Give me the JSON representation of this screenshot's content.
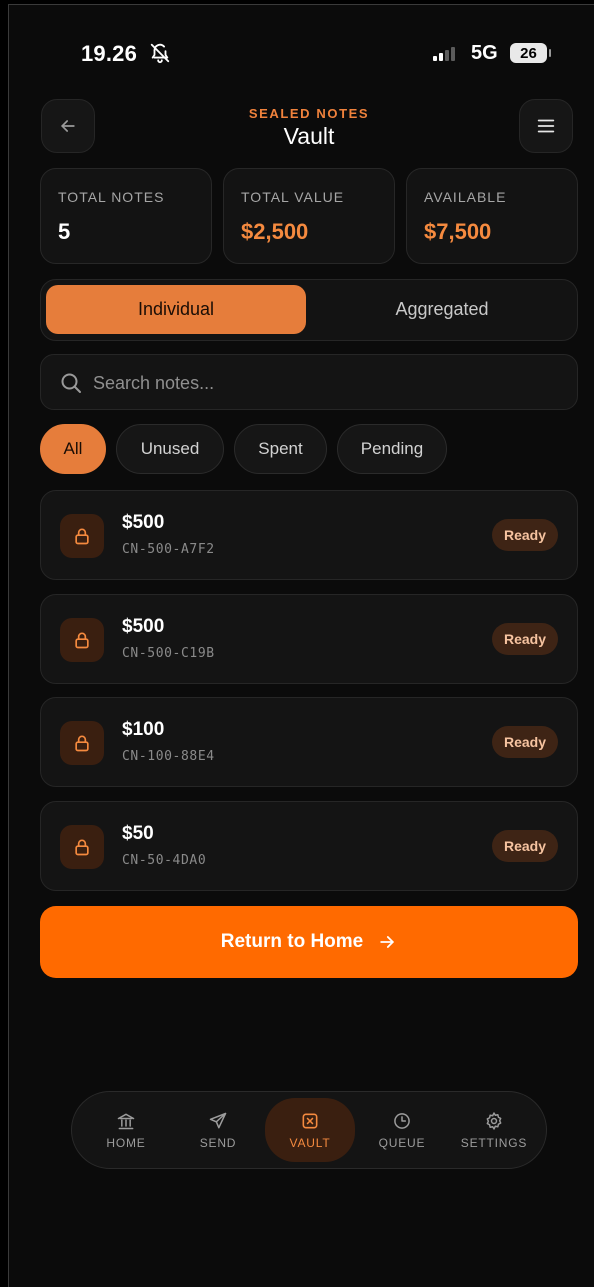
{
  "status_bar": {
    "time": "19.26",
    "network": "5G",
    "battery": "26"
  },
  "header": {
    "eyebrow": "SEALED NOTES",
    "title": "Vault"
  },
  "stats": [
    {
      "label": "TOTAL NOTES",
      "value": "5"
    },
    {
      "label": "TOTAL VALUE",
      "value": "$2,500"
    },
    {
      "label": "AVAILABLE",
      "value": "$7,500"
    }
  ],
  "view_toggle": {
    "individual": "Individual",
    "aggregated": "Aggregated",
    "selected": "Individual"
  },
  "search": {
    "placeholder": "Search notes...",
    "value": ""
  },
  "filters": [
    "All",
    "Unused",
    "Spent",
    "Pending"
  ],
  "active_filter": "All",
  "notes": [
    {
      "amount": "$500",
      "code": "CN-500-A7F2",
      "status": "Ready"
    },
    {
      "amount": "$500",
      "code": "CN-500-C19B",
      "status": "Ready"
    },
    {
      "amount": "$100",
      "code": "CN-100-88E4",
      "status": "Ready"
    },
    {
      "amount": "$50",
      "code": "CN-50-4DA0",
      "status": "Ready"
    }
  ],
  "cta": {
    "label": "Return to Home"
  },
  "nav": [
    {
      "label": "HOME",
      "icon": "bank-icon"
    },
    {
      "label": "SEND",
      "icon": "send-icon"
    },
    {
      "label": "VAULT",
      "icon": "vault-icon"
    },
    {
      "label": "QUEUE",
      "icon": "clock-icon"
    },
    {
      "label": "SETTINGS",
      "icon": "gear-icon"
    }
  ],
  "active_nav": "VAULT",
  "colors": {
    "accent": "#f58a3f",
    "cta": "#ff6a00",
    "background": "#0b0b0b",
    "card": "#141414"
  }
}
